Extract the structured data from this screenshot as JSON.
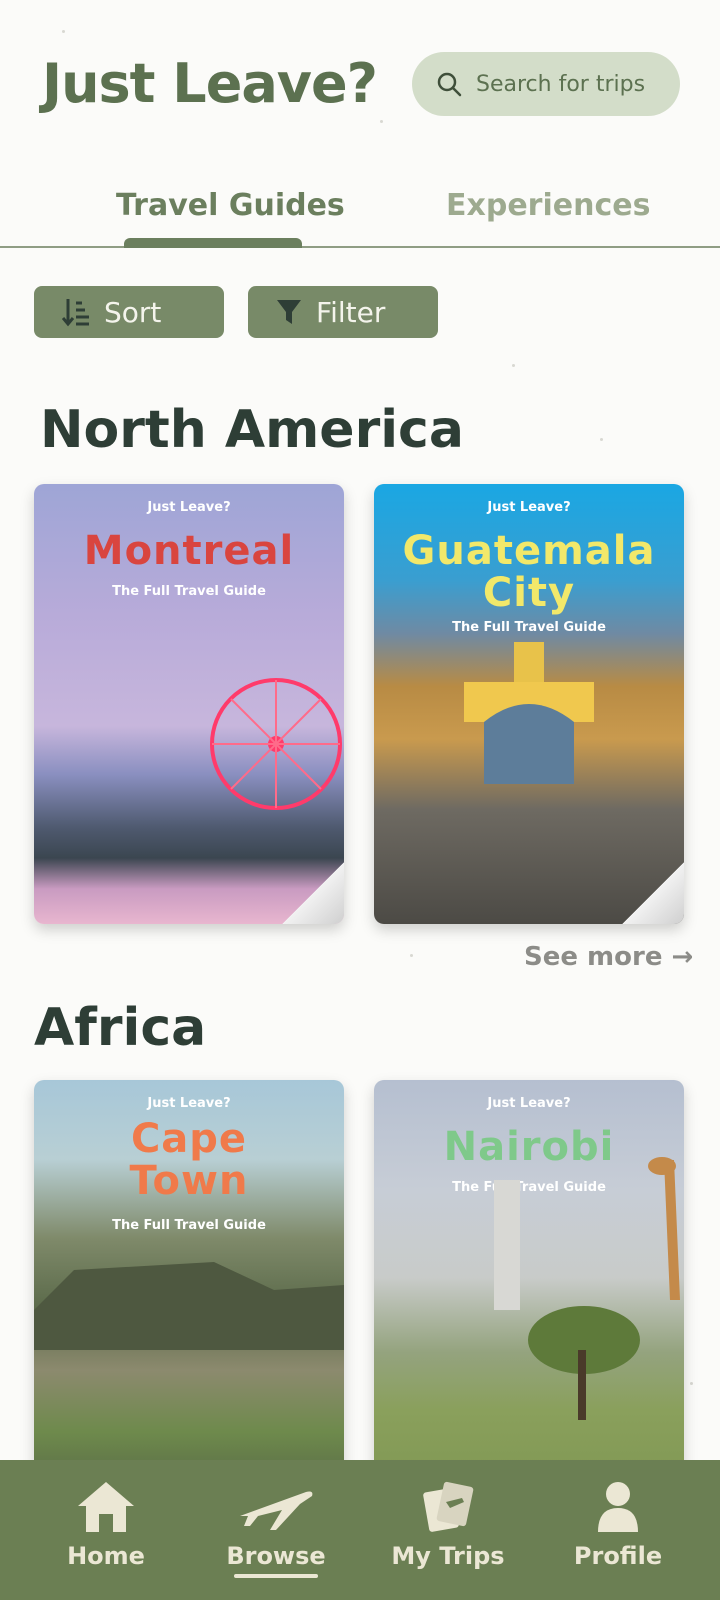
{
  "header": {
    "logo": "Just Leave?",
    "search_placeholder": "Search for trips"
  },
  "tabs": [
    {
      "label": "Travel Guides",
      "active": true
    },
    {
      "label": "Experiences",
      "active": false
    }
  ],
  "controls": {
    "sort_label": "Sort",
    "filter_label": "Filter"
  },
  "sections": [
    {
      "title": "North America",
      "see_more": "See more →",
      "cards": [
        {
          "brand": "Just Leave?",
          "city": "Montreal",
          "subtitle": "The Full Travel Guide",
          "city_color": "#d9453f"
        },
        {
          "brand": "Just Leave?",
          "city": "Guatemala City",
          "subtitle": "The Full Travel Guide",
          "city_color": "#f2e86a"
        }
      ]
    },
    {
      "title": "Africa",
      "cards": [
        {
          "brand": "Just Leave?",
          "city": "Cape Town",
          "subtitle": "The Full Travel Guide",
          "city_color": "#f07a4a"
        },
        {
          "brand": "Just Leave?",
          "city": "Nairobi",
          "subtitle": "The Full Travel Guide",
          "city_color": "#7fc98a"
        }
      ]
    }
  ],
  "nav": [
    {
      "label": "Home",
      "icon": "home-icon",
      "active": false
    },
    {
      "label": "Browse",
      "icon": "airplane-icon",
      "active": true
    },
    {
      "label": "My Trips",
      "icon": "tickets-icon",
      "active": false
    },
    {
      "label": "Profile",
      "icon": "person-icon",
      "active": false
    }
  ],
  "colors": {
    "brand_green": "#5c7150",
    "nav_bg": "#6b7f53",
    "button_bg": "#788a68"
  }
}
